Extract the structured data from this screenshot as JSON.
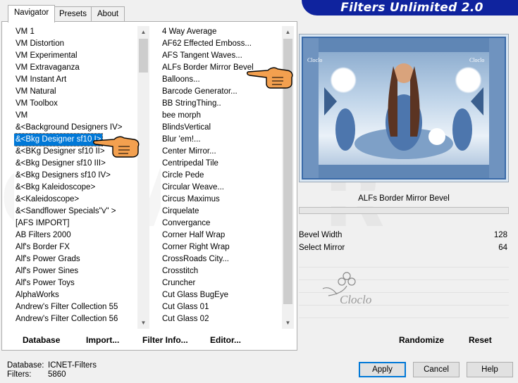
{
  "tabs": [
    {
      "label": "Navigator",
      "active": true
    },
    {
      "label": "Presets",
      "active": false
    },
    {
      "label": "About",
      "active": false
    }
  ],
  "brand": "Filters Unlimited 2.0",
  "categories": [
    "VM 1",
    "VM Distortion",
    "VM Experimental",
    "VM Extravaganza",
    "VM Instant Art",
    "VM Natural",
    "VM Toolbox",
    "VM",
    "&<Background Designers IV>",
    "&<Bkg Designer sf10 I>",
    "&<BKg Designer sf10 II>",
    "&<Bkg Designer sf10 III>",
    "&<Bkg Designers sf10 IV>",
    "&<Bkg Kaleidoscope>",
    "&<Kaleidoscope>",
    "&<Sandflower Specials\"v\" >",
    "[AFS IMPORT]",
    "AB Filters 2000",
    "Alf's Border FX",
    "Alf's Power Grads",
    "Alf's Power Sines",
    "Alf's Power Toys",
    "AlphaWorks",
    "Andrew's Filter Collection 55",
    "Andrew's Filter Collection 56"
  ],
  "selected_category_index": 9,
  "filters": [
    "4 Way Average",
    "AF62 Effected Emboss...",
    "AFS Tangent Waves...",
    "ALFs Border Mirror Bevel",
    "Balloons...",
    "Barcode Generator...",
    "BB StringThing..",
    "bee morph",
    "BlindsVertical",
    "Blur 'em!...",
    "Center Mirror...",
    "Centripedal Tile",
    "Circle Pede",
    "Circular Weave...",
    "Circus Maximus",
    "Cirquelate",
    "Convergance",
    "Corner Half Wrap",
    "Corner Right Wrap",
    "CrossRoads City...",
    "Crosstitch",
    "Cruncher",
    "Cut Glass  BugEye",
    "Cut Glass 01",
    "Cut Glass 02"
  ],
  "selected_filter_name": "ALFs Border Mirror Bevel",
  "parameters": [
    {
      "label": "Bevel Width",
      "value": "128"
    },
    {
      "label": "Select Mirror",
      "value": "64"
    }
  ],
  "preview": {
    "watermark_text": "Cloclo",
    "tiles_text": "Cloclo"
  },
  "bottom_buttons": {
    "database": "Database",
    "import": "Import...",
    "filter_info": "Filter Info...",
    "editor": "Editor...",
    "randomize": "Randomize",
    "reset": "Reset"
  },
  "status": {
    "database_label": "Database:",
    "database_value": "ICNET-Filters",
    "filters_label": "Filters:",
    "filters_value": "5860"
  },
  "dialog_buttons": {
    "apply": "Apply",
    "cancel": "Cancel",
    "help": "Help"
  },
  "colors": {
    "selection": "#0078d7",
    "brand_bg": "#0f239e",
    "hand": "#f3a04f"
  }
}
